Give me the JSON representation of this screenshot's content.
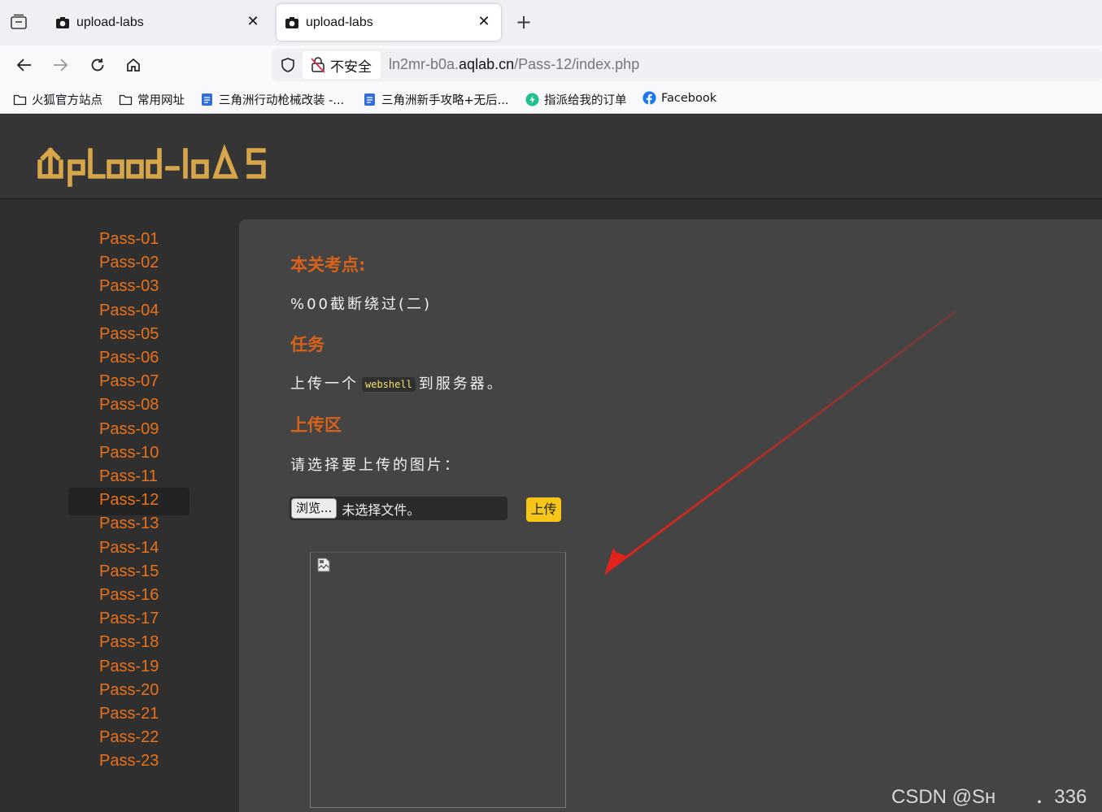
{
  "browser": {
    "tabs": [
      {
        "title": "upload-labs",
        "active": false
      },
      {
        "title": "upload-labs",
        "active": true
      }
    ],
    "security_label": "不安全",
    "url": {
      "prefix": "ln2mr-b0a.",
      "domain": "aqlab.cn",
      "path": "/Pass-12/index.php"
    },
    "bookmarks": [
      {
        "label": "火狐官方站点",
        "icon": "folder-icon"
      },
      {
        "label": "常用网址",
        "icon": "folder-icon"
      },
      {
        "label": "三角洲行动枪械改装 -...",
        "icon": "doc-icon"
      },
      {
        "label": "三角洲新手攻略+无后...",
        "icon": "doc-icon"
      },
      {
        "label": "指派给我的订单",
        "icon": "bolt-icon"
      },
      {
        "label": "Facebook",
        "icon": "facebook-icon"
      }
    ]
  },
  "site": {
    "logo_text": "UpLoad-labs",
    "nav": [
      "Pass-01",
      "Pass-02",
      "Pass-03",
      "Pass-04",
      "Pass-05",
      "Pass-06",
      "Pass-07",
      "Pass-08",
      "Pass-09",
      "Pass-10",
      "Pass-11",
      "Pass-12",
      "Pass-13",
      "Pass-14",
      "Pass-15",
      "Pass-16",
      "Pass-17",
      "Pass-18",
      "Pass-19",
      "Pass-20",
      "Pass-21",
      "Pass-22",
      "Pass-23"
    ],
    "active_pass": "Pass-12"
  },
  "content": {
    "section1_title": "本关考点:",
    "section1_text": "%00截断绕过(二)",
    "section2_title": "任务",
    "task_prefix": "上传一个",
    "task_code": "webshell",
    "task_suffix": "到服务器。",
    "section3_title": "上传区",
    "upload_prompt": "请选择要上传的图片：",
    "browse_label": "浏览...",
    "no_file_label": "未选择文件。",
    "upload_button": "上传"
  },
  "watermark": "CSDN @Sн　　．336",
  "colors": {
    "accent": "#e8711b",
    "heading": "#d9621a",
    "upload_button": "#f5c518",
    "arrow": "#e0241b"
  }
}
